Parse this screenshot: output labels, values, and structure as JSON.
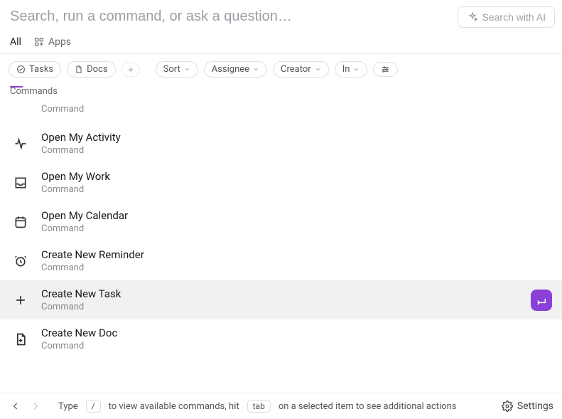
{
  "header": {
    "search_placeholder": "Search, run a command, or ask a question…",
    "search_ai_label": "Search with AI"
  },
  "tabs": {
    "all": "All",
    "apps": "Apps",
    "active": "all"
  },
  "filters": {
    "tasks": "Tasks",
    "docs": "Docs",
    "sort": "Sort",
    "assignee": "Assignee",
    "creator": "Creator",
    "in": "In"
  },
  "section_label": "Commands",
  "commands": [
    {
      "id": "truncated-prev",
      "title": "",
      "subtitle": "Command",
      "icon": "",
      "selected": false
    },
    {
      "id": "open-activity",
      "title": "Open My Activity",
      "subtitle": "Command",
      "icon": "activity",
      "selected": false
    },
    {
      "id": "open-work",
      "title": "Open My Work",
      "subtitle": "Command",
      "icon": "inbox",
      "selected": false
    },
    {
      "id": "open-calendar",
      "title": "Open My Calendar",
      "subtitle": "Command",
      "icon": "calendar",
      "selected": false
    },
    {
      "id": "new-reminder",
      "title": "Create New Reminder",
      "subtitle": "Command",
      "icon": "alarm",
      "selected": false
    },
    {
      "id": "new-task",
      "title": "Create New Task",
      "subtitle": "Command",
      "icon": "plus",
      "selected": true
    },
    {
      "id": "new-doc",
      "title": "Create New Doc",
      "subtitle": "Command",
      "icon": "doc-plus",
      "selected": false
    }
  ],
  "footer": {
    "hint_pre": "Type",
    "key_slash": "/",
    "hint_mid": "to view available commands, hit",
    "key_tab": "tab",
    "hint_post": "on a selected item to see additional actions",
    "settings_label": "Settings"
  }
}
